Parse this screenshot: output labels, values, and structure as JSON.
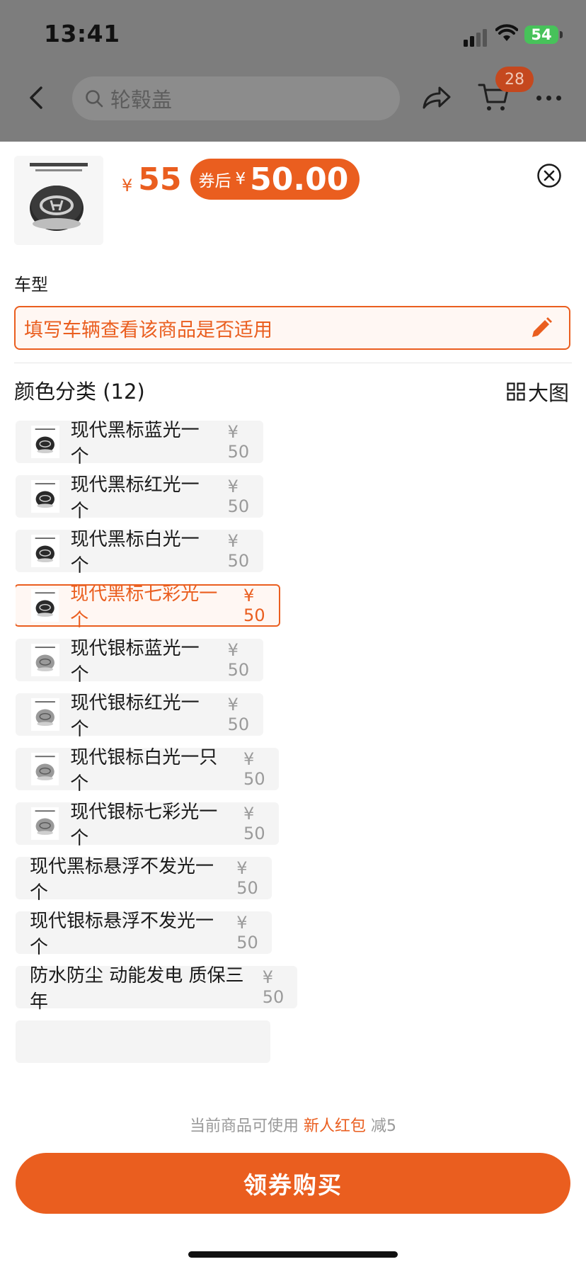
{
  "status_bar": {
    "time": "13:41",
    "battery": "54"
  },
  "nav": {
    "search_placeholder": "轮毂盖",
    "cart_count": "28"
  },
  "product": {
    "yen": "¥",
    "price": "55",
    "coupon_label": "券后",
    "coupon_yen": "¥",
    "coupon_price": "50.00"
  },
  "car": {
    "label": "车型",
    "placeholder": "填写车辆查看该商品是否适用"
  },
  "color_section": {
    "title": "颜色分类 (12)",
    "big_image_label": "大图"
  },
  "options": [
    {
      "name": "现代黑标蓝光一个",
      "price": "¥ 50",
      "image": "black"
    },
    {
      "name": "现代黑标红光一个",
      "price": "¥ 50",
      "image": "black"
    },
    {
      "name": "现代黑标白光一个",
      "price": "¥ 50",
      "image": "black"
    },
    {
      "name": "现代黑标七彩光一个",
      "price": "¥ 50",
      "image": "black",
      "selected": true
    },
    {
      "name": "现代银标蓝光一个",
      "price": "¥ 50",
      "image": "silver"
    },
    {
      "name": "现代银标红光一个",
      "price": "¥ 50",
      "image": "silver"
    },
    {
      "name": "现代银标白光一只个",
      "price": "¥ 50",
      "image": "silver"
    },
    {
      "name": "现代银标七彩光一个",
      "price": "¥ 50",
      "image": "silver"
    },
    {
      "name": "现代黑标悬浮不发光一个",
      "price": "¥ 50",
      "image": "none"
    },
    {
      "name": "现代银标悬浮不发光一个",
      "price": "¥ 50",
      "image": "none"
    },
    {
      "name": "防水防尘 动能发电 质保三年",
      "price": "¥ 50",
      "image": "none"
    }
  ],
  "promo": {
    "prefix": "当前商品可使用",
    "highlight": "新人红包",
    "suffix": "减5"
  },
  "buy_button": "领券购买",
  "colors": {
    "accent": "#ea5e1f",
    "selected_bg": "#fff7f3",
    "option_bg": "#f4f4f4"
  }
}
